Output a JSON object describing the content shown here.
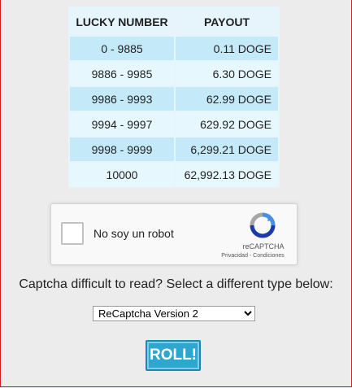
{
  "payout_table": {
    "headers": {
      "lucky_number": "LUCKY NUMBER",
      "payout": "PAYOUT"
    },
    "rows": [
      {
        "range": "0 - 9885",
        "payout": "0.11 DOGE"
      },
      {
        "range": "9886 - 9985",
        "payout": "6.30 DOGE"
      },
      {
        "range": "9986 - 9993",
        "payout": "62.99 DOGE"
      },
      {
        "range": "9994 - 9997",
        "payout": "629.92 DOGE"
      },
      {
        "range": "9998 - 9999",
        "payout": "6,299.21 DOGE"
      },
      {
        "range": "10000",
        "payout": "62,992.13 DOGE"
      }
    ]
  },
  "recaptcha": {
    "checkbox_label": "No soy un robot",
    "brand": "reCAPTCHA",
    "terms": "Privacidad - Condiciones",
    "logo_icon": "recaptcha-logo-icon"
  },
  "captcha_help": "Captcha difficult to read? Select a different type below:",
  "captcha_select": {
    "selected": "ReCaptcha Version 2"
  },
  "roll_button": {
    "label": "ROLL!"
  },
  "colors": {
    "row_shade": "#c4e9f9",
    "row_light": "#e6f7fd",
    "roll_button": "#2fa6ce",
    "frame_border": "#cc2222"
  }
}
